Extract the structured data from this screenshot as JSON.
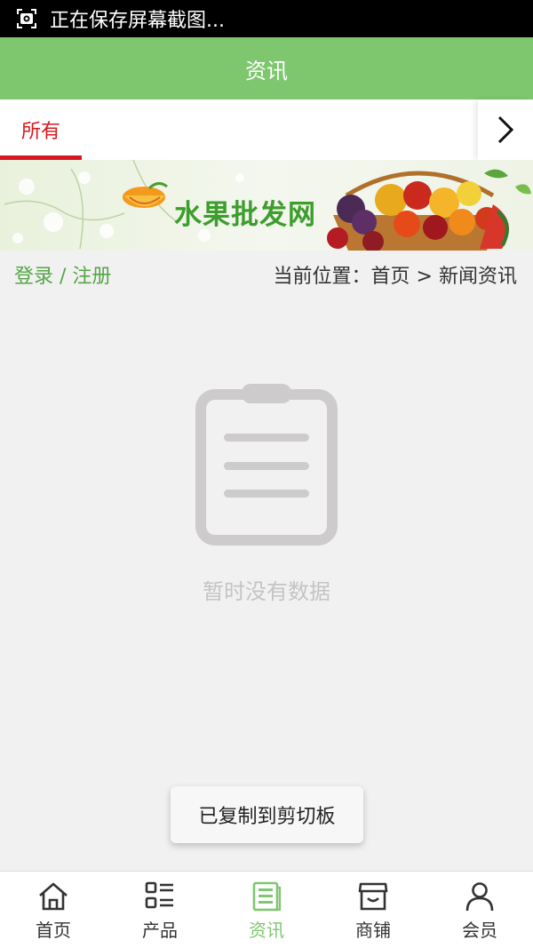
{
  "status_bar": {
    "text": "正在保存屏幕截图..."
  },
  "header": {
    "title": "资讯"
  },
  "tabs": [
    {
      "label": "所有",
      "active": true
    }
  ],
  "banner": {
    "title": "水果批发网"
  },
  "crumb": {
    "login_text": "登录 / 注册",
    "location_label": "当前位置：",
    "home": "首页",
    "separator": " > ",
    "current": "新闻资讯"
  },
  "empty": {
    "message": "暂时没有数据"
  },
  "toast": {
    "message": "已复制到剪切板"
  },
  "bottom_nav": [
    {
      "label": "首页",
      "icon": "home-icon",
      "active": false
    },
    {
      "label": "产品",
      "icon": "list-grid-icon",
      "active": false
    },
    {
      "label": "资讯",
      "icon": "news-icon",
      "active": true
    },
    {
      "label": "商铺",
      "icon": "shop-icon",
      "active": false
    },
    {
      "label": "会员",
      "icon": "user-icon",
      "active": false
    }
  ],
  "colors": {
    "header_green": "#7ec76f",
    "active_red": "#d7191f",
    "login_green": "#55a546"
  }
}
